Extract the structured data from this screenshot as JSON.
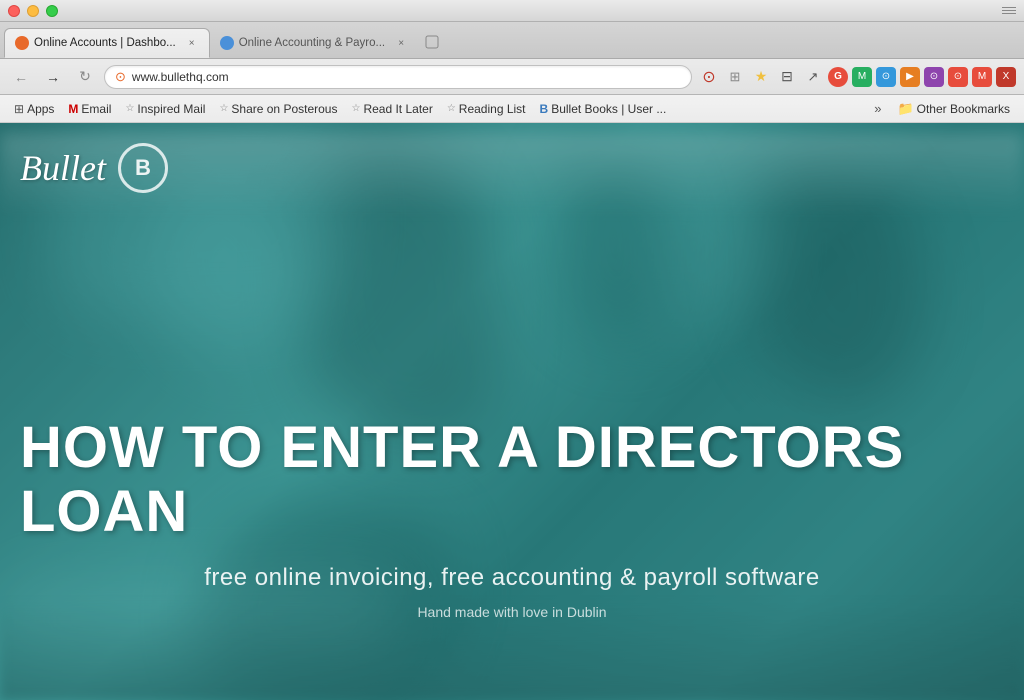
{
  "window": {
    "title": "Online Accounts | Dashboard",
    "controls": {
      "close": "×",
      "minimize": "–",
      "maximize": "+"
    }
  },
  "tabs": [
    {
      "id": "tab1",
      "label": "Online Accounts | Dashbo...",
      "favicon": "orange",
      "active": true,
      "closable": true
    },
    {
      "id": "tab2",
      "label": "Online Accounting & Payro...",
      "favicon": "blue",
      "active": false,
      "closable": true
    }
  ],
  "address_bar": {
    "url": "www.bullethq.com",
    "favicon": "●"
  },
  "toolbar_icons": [
    "⊙",
    "⊞",
    "★",
    "⊟",
    "↗",
    "⊠",
    "⊙",
    "⊙",
    "⊙",
    "⊙",
    "⊙",
    "⊙",
    "⊙",
    "⊙",
    "⊙"
  ],
  "bookmarks": [
    {
      "id": "apps",
      "label": "Apps",
      "icon": "⊞",
      "type": "apps"
    },
    {
      "id": "email",
      "label": "Email",
      "icon": "M",
      "color": "#cc0000"
    },
    {
      "id": "inspired-mail",
      "label": "Inspired Mail",
      "icon": "☆"
    },
    {
      "id": "share-on-posterous",
      "label": "Share on Posterous",
      "icon": "☆"
    },
    {
      "id": "read-it-later",
      "label": "Read It Later",
      "icon": "☆"
    },
    {
      "id": "reading-list",
      "label": "Reading List",
      "icon": "☆"
    },
    {
      "id": "bullet-books",
      "label": "Bullet Books | User ...",
      "icon": "B",
      "color": "#3a7abd"
    }
  ],
  "bookmarks_overflow": "»",
  "other_bookmarks": "Other Bookmarks",
  "page": {
    "logo_text": "Bullet",
    "logo_circle": "B",
    "hero_title": "HOW TO ENTER A DIRECTORS LOAN",
    "hero_subtitle": "free online invoicing, free accounting & payroll software",
    "hero_tagline": "Hand made with love in Dublin"
  }
}
